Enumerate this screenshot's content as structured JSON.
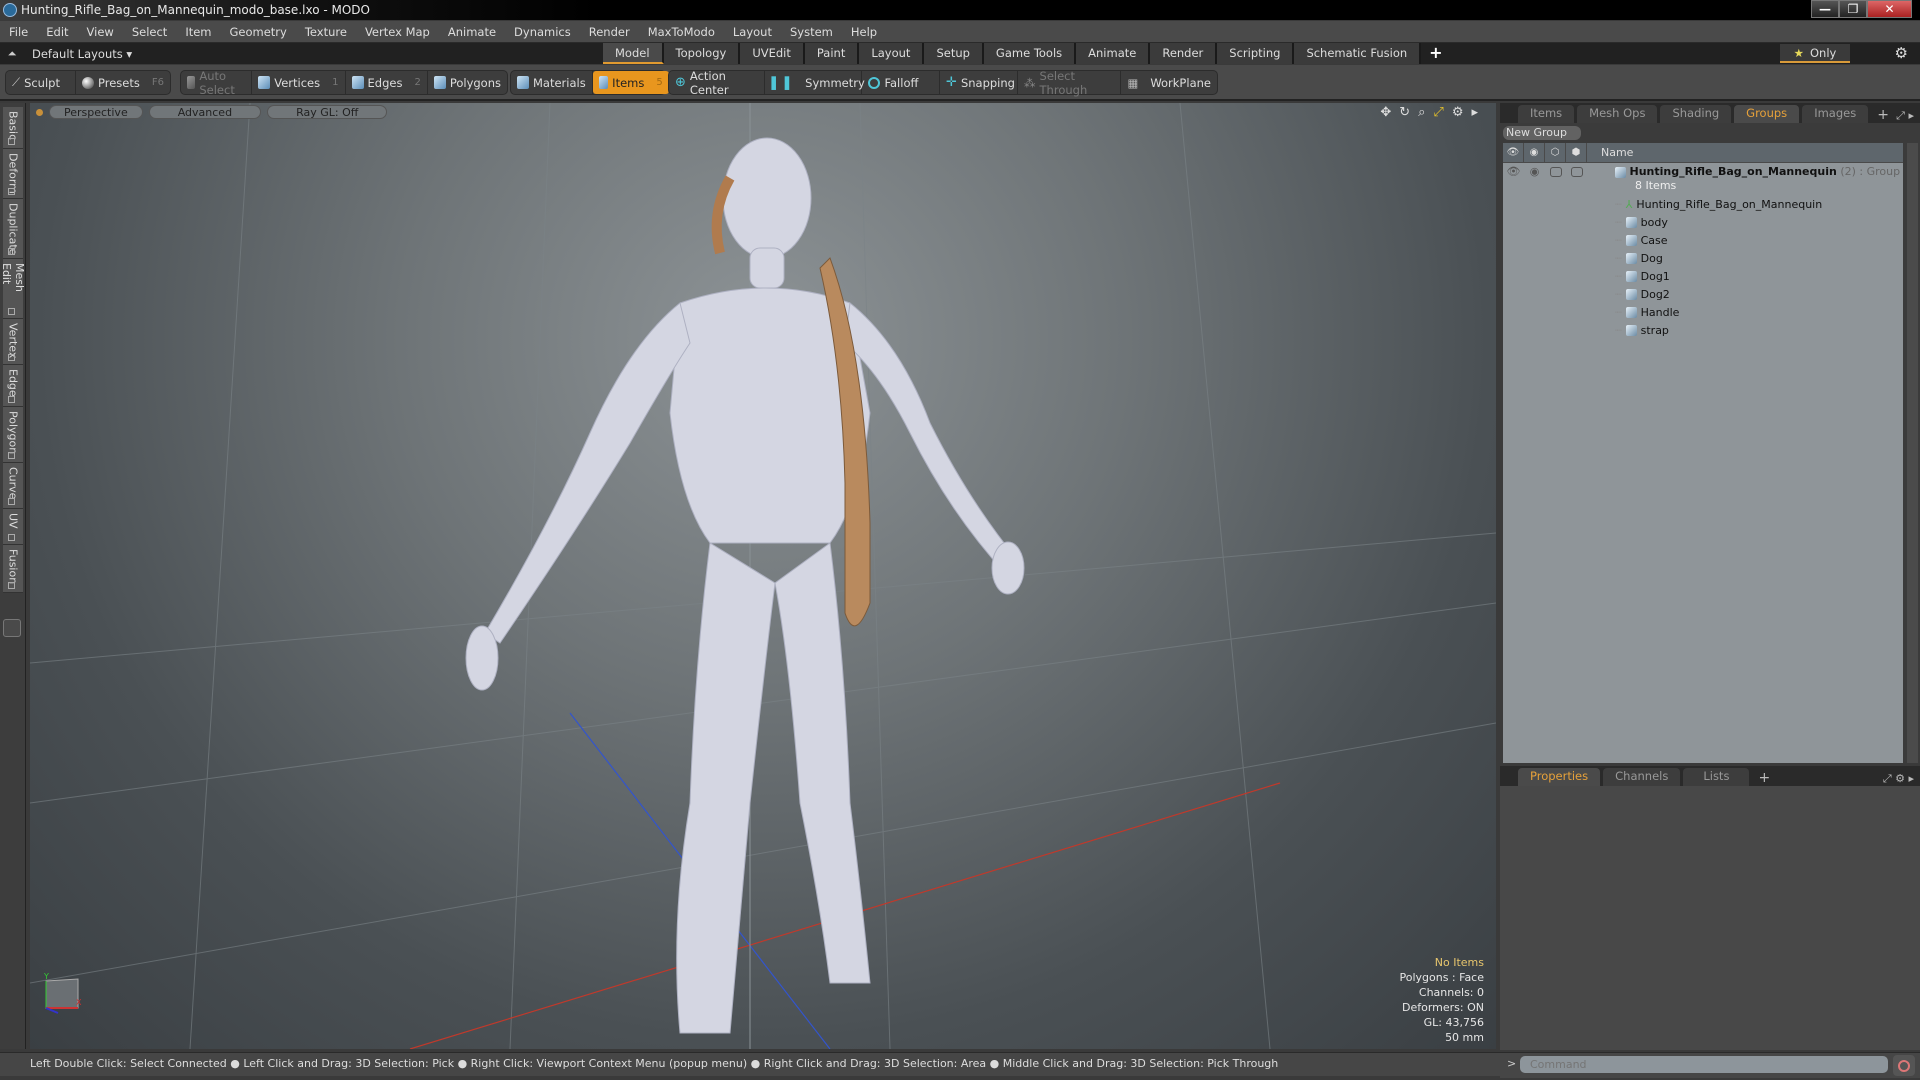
{
  "window": {
    "title": "Hunting_Rifle_Bag_on_Mannequin_modo_base.lxo - MODO",
    "minimize": "—",
    "maximize": "❐",
    "close": "✕"
  },
  "menu": [
    "File",
    "Edit",
    "View",
    "Select",
    "Item",
    "Geometry",
    "Texture",
    "Vertex Map",
    "Animate",
    "Dynamics",
    "Render",
    "MaxToModo",
    "Layout",
    "System",
    "Help"
  ],
  "layoutbar": {
    "layouts_label": "Default Layouts ▾",
    "tabs": [
      "Model",
      "Topology",
      "UVEdit",
      "Paint",
      "Layout",
      "Setup",
      "Game Tools",
      "Animate",
      "Render",
      "Scripting",
      "Schematic Fusion"
    ],
    "active_tab": "Model",
    "add": "+",
    "only_label": "Only",
    "star": "★",
    "gear": "⚙"
  },
  "toolbar": {
    "sculpt": "Sculpt",
    "presets": "Presets",
    "presets_key": "F6",
    "auto_select": "Auto Select",
    "vertices": "Vertices",
    "vertices_key": "1",
    "edges": "Edges",
    "edges_key": "2",
    "polygons": "Polygons",
    "materials": "Materials",
    "items": "Items",
    "items_key": "5",
    "action_center": "Action Center",
    "symmetry": "Symmetry",
    "falloff": "Falloff",
    "snapping": "Snapping",
    "select_through": "Select Through",
    "workplane": "WorkPlane"
  },
  "left_tabs": [
    "Basic",
    "Deform",
    "Duplicate",
    "Mesh Edit",
    "Vertex",
    "Edge",
    "Polygon",
    "Curve",
    "UV",
    "Fusion"
  ],
  "viewport": {
    "view_mode": "Perspective",
    "shading": "Advanced",
    "raygl": "Ray GL: Off",
    "info": {
      "selection": "No Items",
      "polygons": "Polygons : Face",
      "channels": "Channels: 0",
      "deformers": "Deformers: ON",
      "gl": "GL: 43,756",
      "scale": "50 mm"
    },
    "axis": {
      "y": "Y",
      "x": "X"
    }
  },
  "status": "Left Double Click: Select Connected ● Left Click and Drag: 3D Selection: Pick ● Right Click: Viewport Context Menu (popup menu) ● Right Click and Drag: 3D Selection: Area ● Middle Click and Drag: 3D Selection: Pick Through",
  "groups_panel": {
    "tabs": [
      "Items",
      "Mesh Ops",
      "Shading",
      "Groups",
      "Images"
    ],
    "active_tab": "Groups",
    "add": "+",
    "new_group": "New Group",
    "name_header": "Name",
    "group": {
      "name": "Hunting_Rifle_Bag_on_Mannequin",
      "count": "(2)",
      "type": ": Group",
      "items_count": "8 Items"
    },
    "items": [
      {
        "name": "Hunting_Rifle_Bag_on_Mannequin",
        "icon": "locator-icon"
      },
      {
        "name": "body",
        "icon": "mesh-icon"
      },
      {
        "name": "Case",
        "icon": "mesh-icon"
      },
      {
        "name": "Dog",
        "icon": "mesh-icon"
      },
      {
        "name": "Dog1",
        "icon": "mesh-icon"
      },
      {
        "name": "Dog2",
        "icon": "mesh-icon"
      },
      {
        "name": "Handle",
        "icon": "mesh-icon"
      },
      {
        "name": "strap",
        "icon": "mesh-icon"
      }
    ]
  },
  "properties_panel": {
    "tabs": [
      "Properties",
      "Channels",
      "Lists"
    ],
    "active_tab": "Properties",
    "add": "+"
  },
  "command": {
    "prompt": ">",
    "placeholder": "Command"
  },
  "colors": {
    "accent": "#e8961e",
    "active_tab_text": "#e6a13a"
  }
}
